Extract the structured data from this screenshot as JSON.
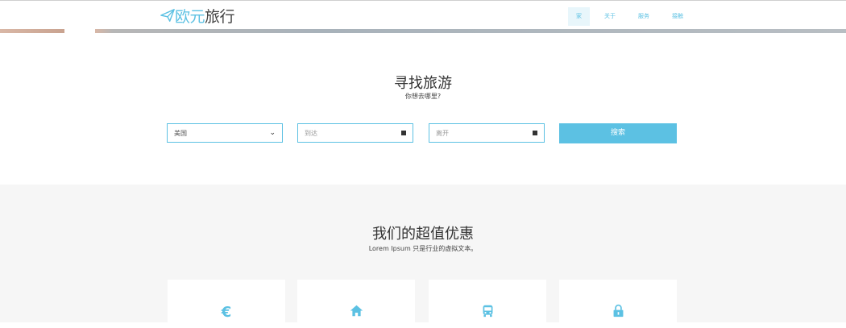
{
  "brand": {
    "part1": "欧元",
    "part2": "旅行",
    "logo_icon": "paper-plane-icon"
  },
  "nav": {
    "items": [
      {
        "label": "家"
      },
      {
        "label": "关于"
      },
      {
        "label": "服务"
      },
      {
        "label": "接触"
      }
    ]
  },
  "search": {
    "title": "寻找旅游",
    "subtitle": "你想去哪里?",
    "country_value": "美国",
    "arrive_placeholder": "到达",
    "depart_placeholder": "离开",
    "button": "搜索"
  },
  "deals": {
    "title": "我们的超值优惠",
    "subtitle": "Lorem Ipsum 只是行业的虚拟文本。",
    "cards": [
      {
        "icon": "euro-icon",
        "glyph": "€"
      },
      {
        "icon": "home-icon"
      },
      {
        "icon": "bus-icon"
      },
      {
        "icon": "lock-icon"
      }
    ]
  },
  "colors": {
    "accent": "#5cc1e3",
    "section_bg": "#f6f6f6",
    "text": "#333333"
  }
}
